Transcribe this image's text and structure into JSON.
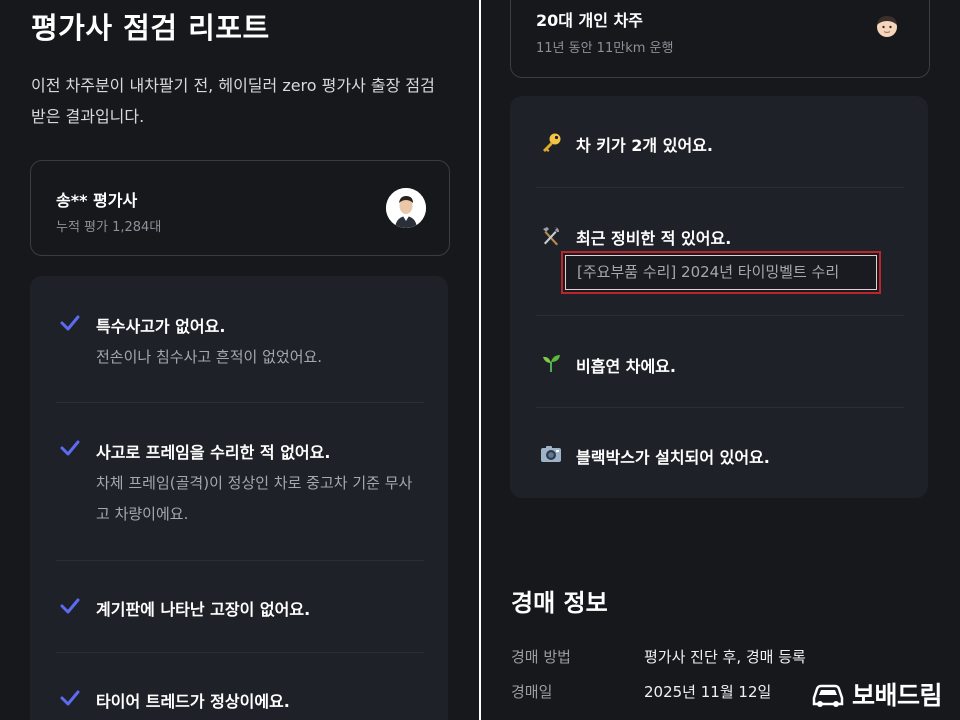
{
  "left": {
    "title": "평가사 점검 리포트",
    "intro": "이전 차주분이 내차팔기 전, 헤이딜러 zero 평가사 출장 점검받은 결과입니다.",
    "inspector": {
      "name": "송** 평가사",
      "count": "누적 평가 1,284대"
    },
    "checks": [
      {
        "title": "특수사고가 없어요.",
        "desc": "전손이나 침수사고 흔적이 없었어요."
      },
      {
        "title": "사고로 프레임을 수리한 적 없어요.",
        "desc": "차체 프레임(골격)이 정상인 차로 중고차 기준 무사고 차량이에요."
      },
      {
        "title": "계기판에 나타난 고장이 없어요.",
        "desc": ""
      },
      {
        "title": "타이어 트레드가 정상이에요.",
        "desc": ""
      }
    ]
  },
  "right": {
    "owner": {
      "title": "20대 개인 차주",
      "sub": "11년 동안 11만km 운행"
    },
    "features": [
      {
        "icon": "key-icon",
        "label": "차 키가 2개 있어요."
      },
      {
        "icon": "tools-icon",
        "label": "최근 정비한 적 있어요.",
        "detail": "[주요부품 수리] 2024년 타이밍벨트 수리"
      },
      {
        "icon": "seedling-icon",
        "label": "비흡연 차에요."
      },
      {
        "icon": "camera-icon",
        "label": "블랙박스가 설치되어 있어요."
      }
    ],
    "auction": {
      "title": "경매 정보",
      "rows": [
        {
          "label": "경매 방법",
          "value": "평가사 진단 후, 경매 등록"
        },
        {
          "label": "경매일",
          "value": "2025년 11월 12일"
        }
      ]
    }
  },
  "watermark": {
    "text": "보배드림"
  },
  "colors": {
    "check": "#5b6cf2",
    "highlight_border": "#b9262d",
    "background": "#17181c",
    "card": "#1f2128"
  }
}
